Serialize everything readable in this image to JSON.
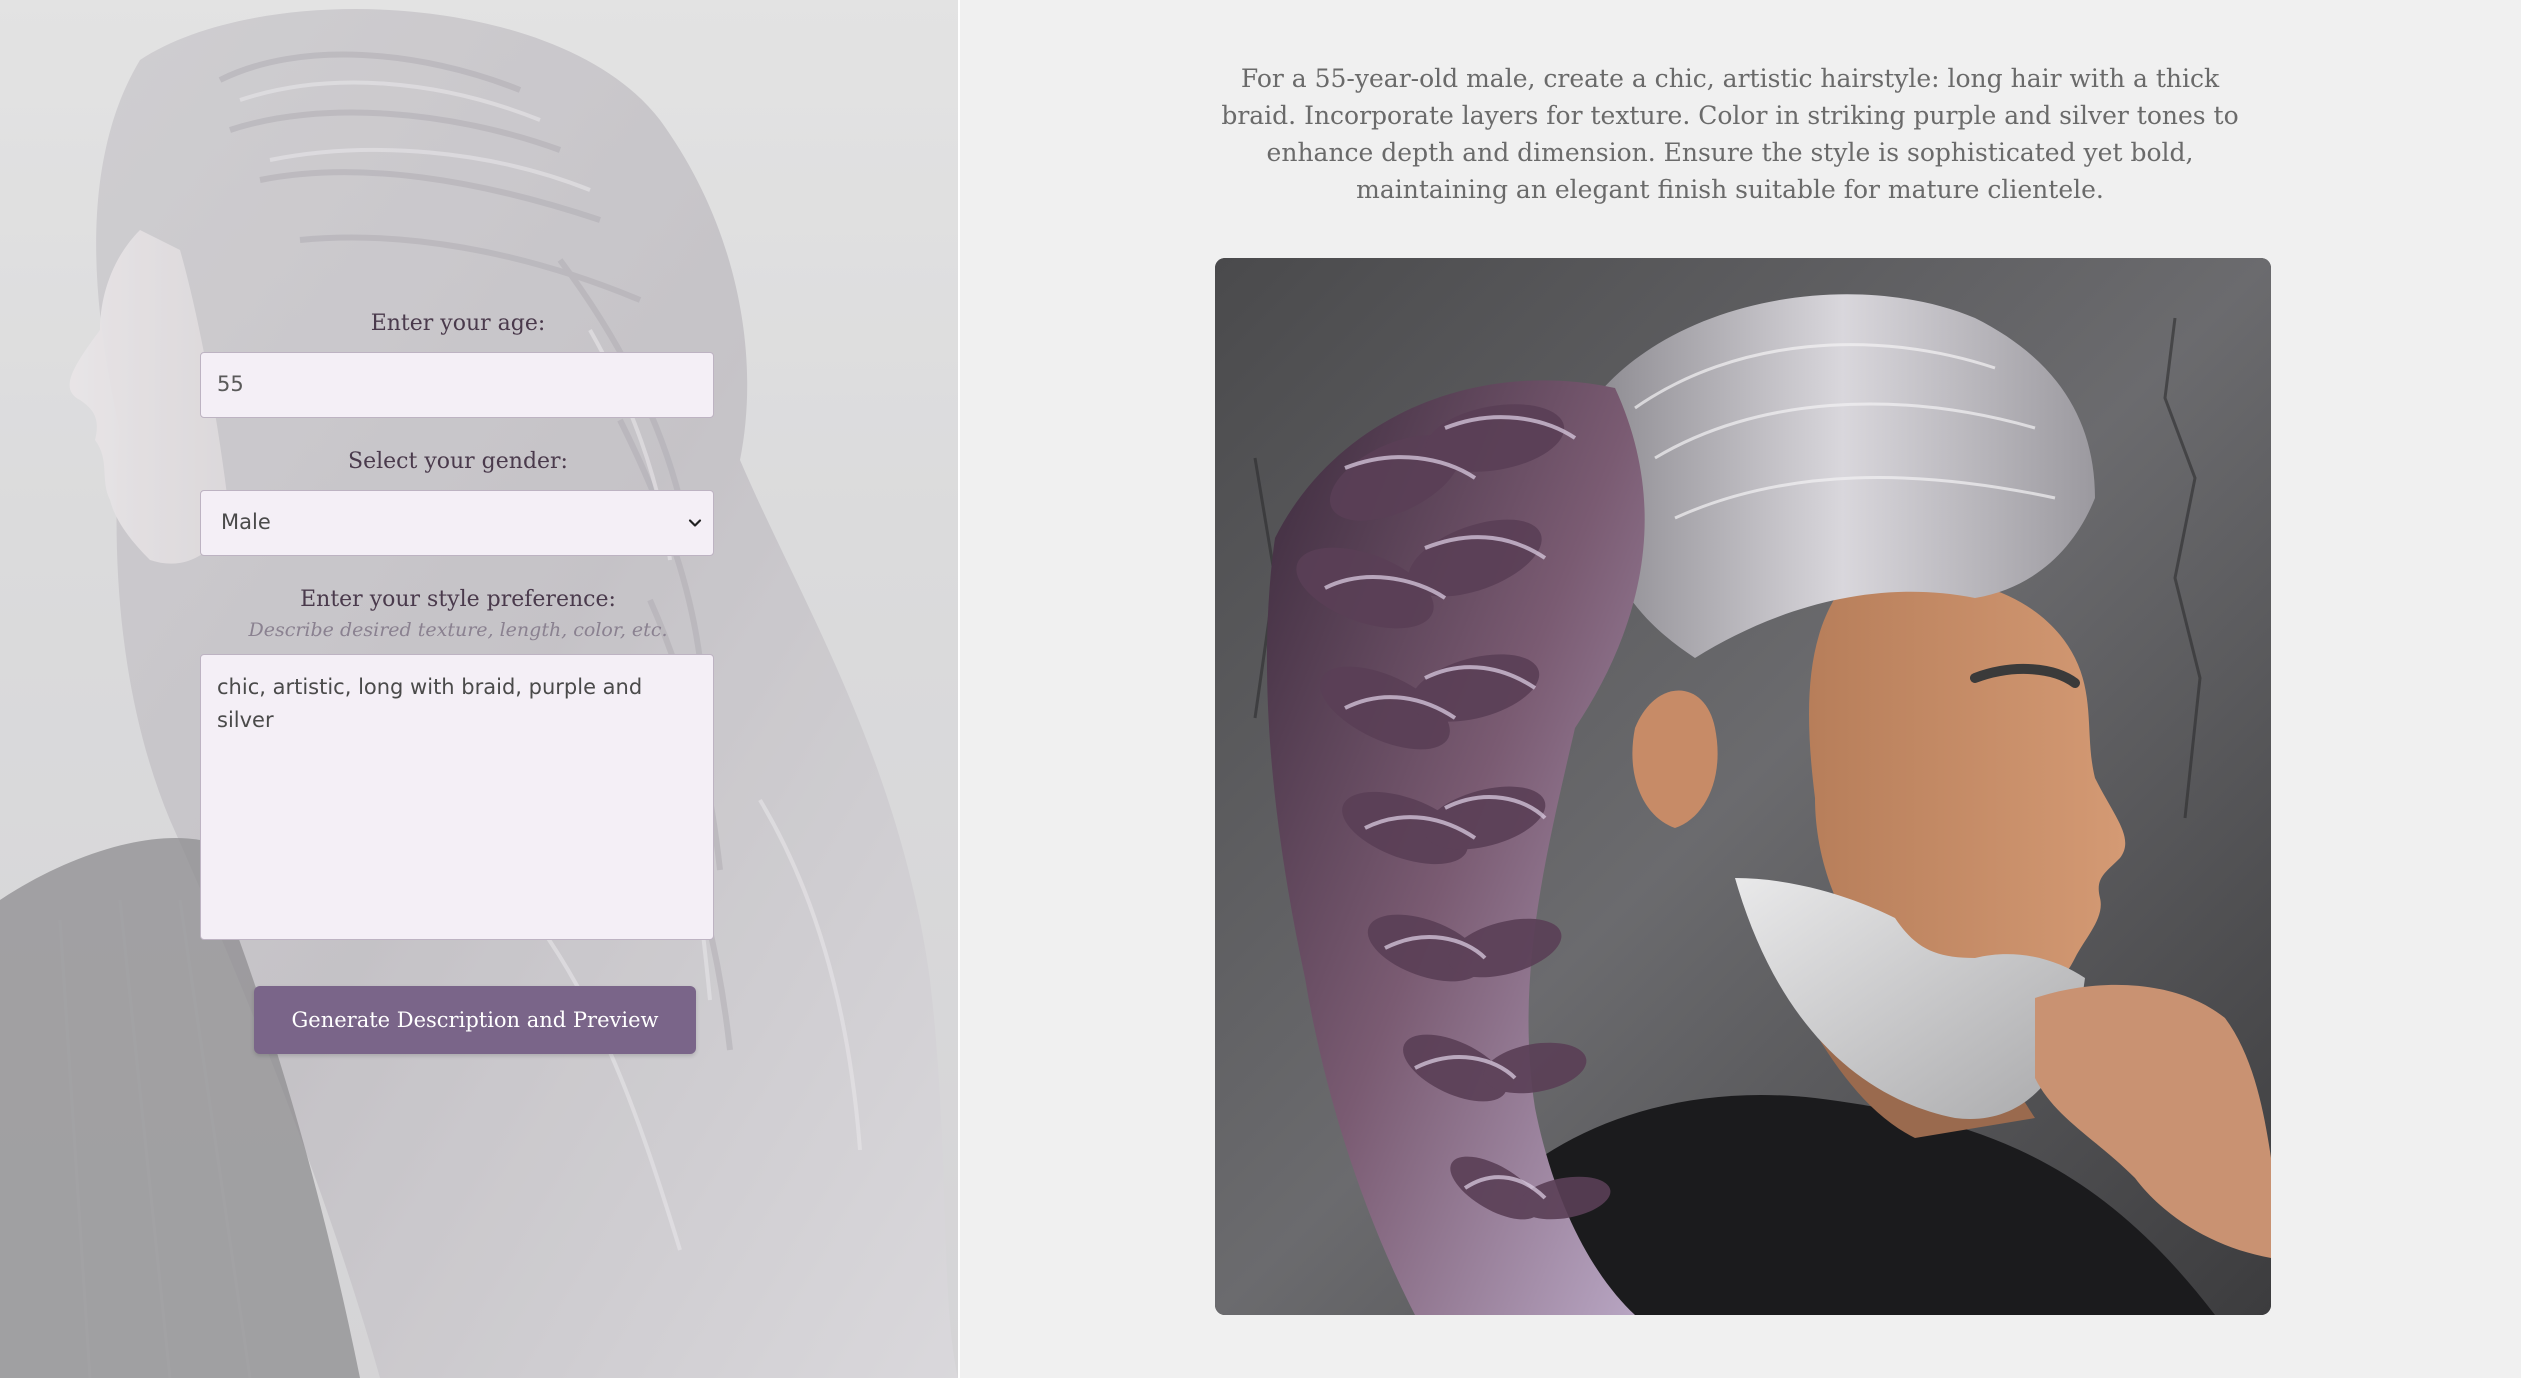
{
  "form": {
    "age_label": "Enter your age:",
    "age_value": "55",
    "gender_label": "Select your gender:",
    "gender_selected": "Male",
    "style_label": "Enter your style preference:",
    "style_hint": "Describe desired texture, length, color, etc.",
    "style_value": "chic, artistic, long with braid, purple and silver",
    "submit_label": "Generate Description and Preview"
  },
  "result": {
    "description": "For a 55-year-old male, create a chic, artistic hairstyle: long hair with a thick braid. Incorporate layers for texture. Color in striking purple and silver tones to enhance depth and dimension. Ensure the style is sophisticated yet bold, maintaining an elegant finish suitable for mature clientele."
  },
  "icons": {
    "select_arrow": "chevron-down-icon"
  },
  "colors": {
    "button": "#7a6589",
    "input_bg": "#f4eff6",
    "label": "#4a3a4c",
    "page_bg": "#f0f0f0"
  }
}
